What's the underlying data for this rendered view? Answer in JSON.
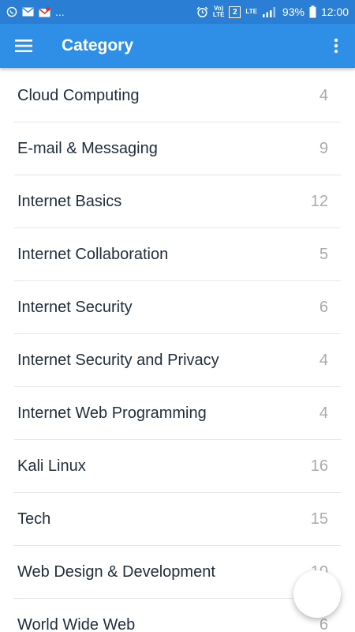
{
  "status_bar": {
    "ellipsis": "...",
    "volte_top": "Vo)",
    "volte_bottom": "LTE",
    "sim": "2",
    "lte": "LTE",
    "battery": "93%",
    "time": "12:00",
    "icons": [
      "whatsapp-icon",
      "mail-icon",
      "gmail-icon",
      "alarm-icon",
      "signal-icon",
      "battery-icon"
    ]
  },
  "app_bar": {
    "title": "Category",
    "icons": [
      "hamburger-menu-icon",
      "more-vert-icon"
    ]
  },
  "categories": [
    {
      "name": "Cloud Computing",
      "count": "4"
    },
    {
      "name": "E-mail & Messaging",
      "count": "9"
    },
    {
      "name": "Internet Basics",
      "count": "12"
    },
    {
      "name": "Internet Collaboration",
      "count": "5"
    },
    {
      "name": "Internet Security",
      "count": "6"
    },
    {
      "name": "Internet Security and Privacy",
      "count": "4"
    },
    {
      "name": "Internet Web Programming",
      "count": "4"
    },
    {
      "name": "Kali Linux",
      "count": "16"
    },
    {
      "name": "Tech",
      "count": "15"
    },
    {
      "name": "Web Design & Development",
      "count": "10"
    },
    {
      "name": "World Wide Web",
      "count": "6"
    }
  ],
  "colors": {
    "status_bar": "#2a7fd4",
    "app_bar": "#2f8fe6",
    "item_text": "#1f2d3a",
    "count_text": "#a7acb1"
  }
}
